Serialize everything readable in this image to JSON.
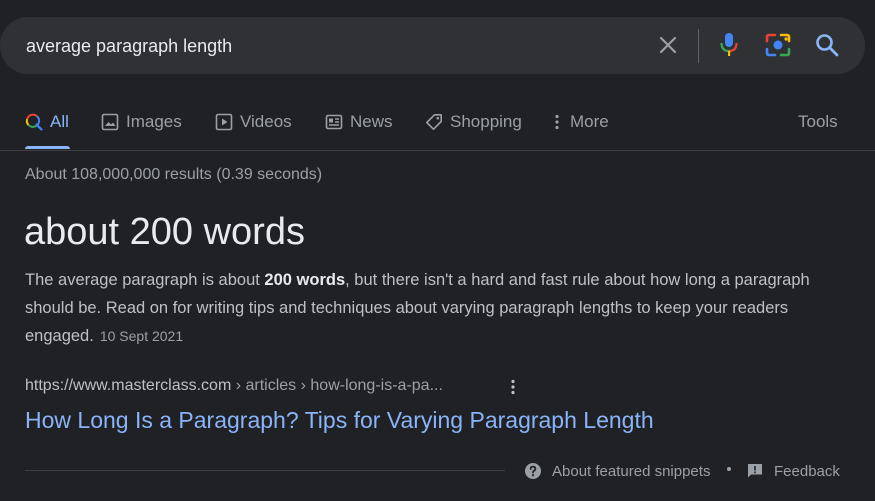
{
  "search": {
    "query": "average paragraph length",
    "clear_icon": "close-icon",
    "voice_icon": "microphone-icon",
    "lens_icon": "camera-lens-icon",
    "search_icon": "search-icon"
  },
  "tabs": [
    {
      "label": "All",
      "icon": "search-icon",
      "active": true
    },
    {
      "label": "Images",
      "icon": "image-icon",
      "active": false
    },
    {
      "label": "Videos",
      "icon": "video-icon",
      "active": false
    },
    {
      "label": "News",
      "icon": "newspaper-icon",
      "active": false
    },
    {
      "label": "Shopping",
      "icon": "tag-icon",
      "active": false
    },
    {
      "label": "More",
      "icon": "more-vertical-icon",
      "active": false
    }
  ],
  "tools_label": "Tools",
  "result_stats": "About 108,000,000 results (0.39 seconds)",
  "featured": {
    "answer": "about 200 words",
    "snippet_before": "The average paragraph is about ",
    "snippet_bold": "200 words",
    "snippet_after": ", but there isn't a hard and fast rule about how long a paragraph should be. Read on for writing tips and techniques about varying paragraph lengths to keep your readers engaged.",
    "date": "10 Sept 2021",
    "cite_domain": "https://www.masterclass.com",
    "cite_path": " › articles › how-long-is-a-pa...",
    "title": "How Long Is a Paragraph? Tips for Varying Paragraph Length"
  },
  "footer": {
    "about_label": "About featured snippets",
    "feedback_label": "Feedback"
  },
  "colors": {
    "background": "#202124",
    "link": "#8ab4f8",
    "text": "#bdc1c6",
    "muted": "#9aa0a6"
  }
}
